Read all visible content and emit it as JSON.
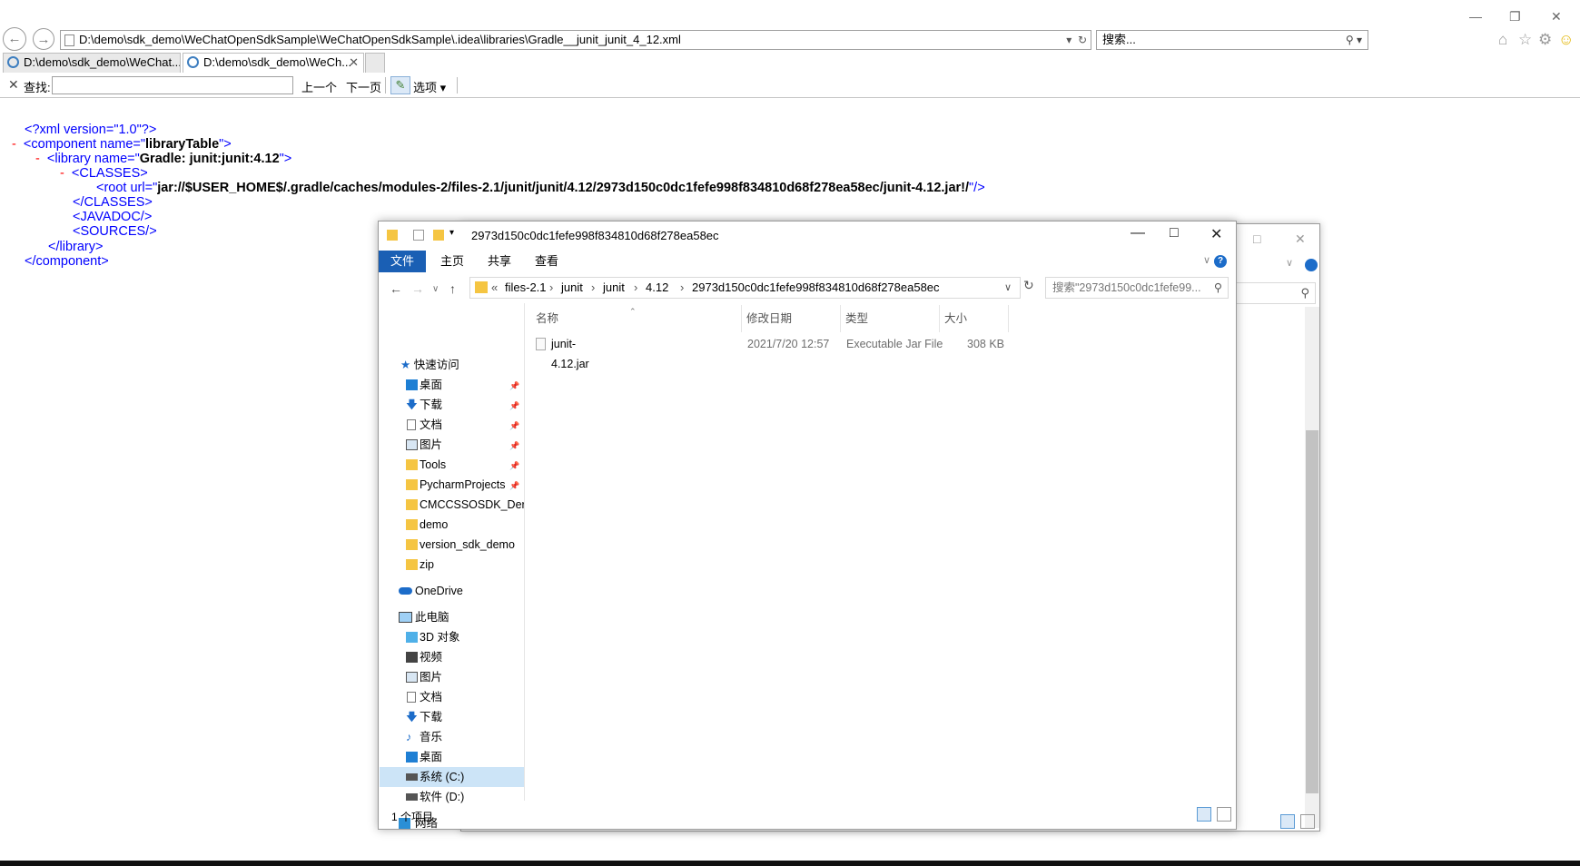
{
  "browser": {
    "address": "D:\\demo\\sdk_demo\\WeChatOpenSdkSample\\WeChatOpenSdkSample\\.idea\\libraries\\Gradle__junit_junit_4_12.xml",
    "search_placeholder": "搜索...",
    "tabs": [
      {
        "label": "D:\\demo\\sdk_demo\\WeChat...",
        "active": false
      },
      {
        "label": "D:\\demo\\sdk_demo\\WeCh...",
        "active": true
      }
    ],
    "find": {
      "label": "查找:",
      "value": "",
      "prev": "上一个",
      "next": "下一页",
      "options": "选项"
    }
  },
  "xml": {
    "decl": "<?xml version=\"1.0\"?>",
    "lines": {
      "comp_open_a": "<component name=\"",
      "comp_name": "libraryTable",
      "comp_open_b": "\">",
      "lib_open_a": "<library name=\"",
      "lib_name": "Gradle: junit:junit:4.12",
      "lib_open_b": "\">",
      "classes_open": "<CLASSES>",
      "root_a": "<root url=\"",
      "root_url": "jar://$USER_HOME$/.gradle/caches/modules-2/files-2.1/junit/junit/4.12/2973d150c0dc1fefe998f834810d68f278ea58ec/junit-4.12.jar!/",
      "root_b": "\"/>",
      "classes_close": "</CLASSES>",
      "javadoc": "<JAVADOC/>",
      "sources": "<SOURCES/>",
      "lib_close": "</library>",
      "comp_close": "</component>",
      "minus": "-"
    }
  },
  "explorer": {
    "title": "2973d150c0dc1fefe998f834810d68f278ea58ec",
    "ribbon_tabs": [
      "文件",
      "主页",
      "共享",
      "查看"
    ],
    "breadcrumb": [
      "files-2.1",
      "junit",
      "junit",
      "4.12",
      "2973d150c0dc1fefe998f834810d68f278ea58ec"
    ],
    "search_placeholder": "搜索\"2973d150c0dc1fefe99...",
    "nav": {
      "quick_access": "快速访问",
      "quick_items": [
        "桌面",
        "下载",
        "文档",
        "图片",
        "Tools",
        "PycharmProjects",
        "CMCCSSOSDK_Der",
        "demo",
        "version_sdk_demo",
        "zip"
      ],
      "onedrive": "OneDrive",
      "this_pc": "此电脑",
      "pc_items": [
        "3D 对象",
        "视频",
        "图片",
        "文档",
        "下载",
        "音乐",
        "桌面",
        "系统 (C:)",
        "软件 (D:)"
      ],
      "network": "网络"
    },
    "columns": {
      "name": "名称",
      "modified": "修改日期",
      "type": "类型",
      "size": "大小"
    },
    "files": [
      {
        "name": "junit-4.12.jar",
        "modified": "2021/7/20 12:57",
        "type": "Executable Jar File",
        "size": "308 KB"
      }
    ],
    "status": "1 个项目"
  },
  "colors": {
    "accent": "#1a5fb4",
    "xml_tag": "#990000",
    "xml_punct": "#0000ff",
    "xml_minus": "#ff0000"
  }
}
